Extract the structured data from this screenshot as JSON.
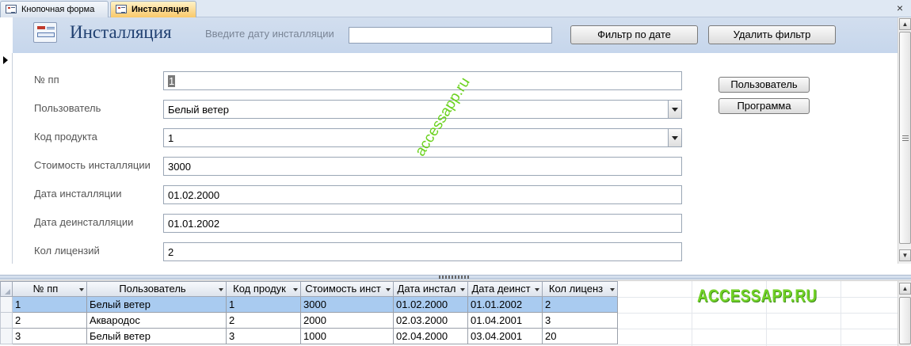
{
  "tabs": [
    {
      "label": "Кнопочная форма",
      "active": false
    },
    {
      "label": "Инсталляция",
      "active": true
    }
  ],
  "header": {
    "title": "Инсталляция",
    "filter_label": "Введите дату инсталляции",
    "filter_value": "",
    "filter_button": "Фильтр по дате",
    "clear_filter_button": "Удалить фильтр"
  },
  "form": {
    "fields": {
      "num": {
        "label": "№ пп",
        "value": "1"
      },
      "user": {
        "label": "Пользователь",
        "value": "Белый ветер"
      },
      "product": {
        "label": "Код продукта",
        "value": "1"
      },
      "cost": {
        "label": "Стоимость инсталляции",
        "value": "3000"
      },
      "install_date": {
        "label": "Дата инсталляции",
        "value": "01.02.2000"
      },
      "uninstall_date": {
        "label": "Дата деинсталляции",
        "value": "01.01.2002"
      },
      "licenses": {
        "label": "Кол лицензий",
        "value": "2"
      }
    },
    "user_button": "Пользователь",
    "program_button": "Программа",
    "watermark": "accessapp.ru"
  },
  "table": {
    "columns": [
      "№ пп",
      "Пользователь",
      "Код продук",
      "Стоимость инст",
      "Дата инстал",
      "Дата деинст",
      "Кол лиценз"
    ],
    "rows": [
      [
        "1",
        "Белый ветер",
        "1",
        "3000",
        "01.02.2000",
        "01.01.2002",
        "2"
      ],
      [
        "2",
        "Аквародос",
        "2",
        "2000",
        "02.03.2000",
        "01.04.2001",
        "3"
      ],
      [
        "3",
        "Белый ветер",
        "3",
        "1000",
        "02.04.2000",
        "03.04.2001",
        "20"
      ]
    ],
    "selected_row": 0,
    "watermark": "ACCESSAPP.RU"
  },
  "colors": {
    "accent_header": "#c6d6ec",
    "selected_row": "#a9cbf0",
    "active_tab": "#f9c96a",
    "watermark": "#6bd21f"
  }
}
